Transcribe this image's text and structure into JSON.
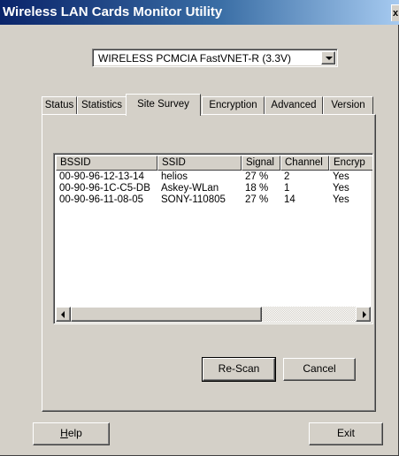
{
  "window": {
    "title": "Wireless LAN Cards Monitor Utility",
    "close_glyph": "x"
  },
  "adapter_select": {
    "value": "WIRELESS PCMCIA FastVNET-R (3.3V)"
  },
  "tabs": [
    {
      "label": "Status",
      "active": false
    },
    {
      "label": "Statistics",
      "active": false
    },
    {
      "label": "Site Survey",
      "active": true
    },
    {
      "label": "Encryption",
      "active": false
    },
    {
      "label": "Advanced",
      "active": false
    },
    {
      "label": "Version",
      "active": false
    }
  ],
  "site_survey": {
    "columns": [
      "BSSID",
      "SSID",
      "Signal",
      "Channel",
      "Encryp"
    ],
    "rows": [
      [
        "00-90-96-12-13-14",
        "helios",
        "27 %",
        "2",
        "Yes"
      ],
      [
        "00-90-96-1C-C5-DB",
        "Askey-WLan",
        "18 %",
        "1",
        "Yes"
      ],
      [
        "00-90-96-11-08-05",
        "SONY-110805",
        "27 %",
        "14",
        "Yes"
      ]
    ],
    "rescan_label": "Re-Scan",
    "cancel_label": "Cancel"
  },
  "footer": {
    "help_label_mnemonic": "H",
    "help_label_rest": "elp",
    "exit_label": "Exit"
  },
  "colors": {
    "title_gradient_start": "#0a246a",
    "title_gradient_end": "#a6caf0",
    "face": "#d4d0c8"
  }
}
